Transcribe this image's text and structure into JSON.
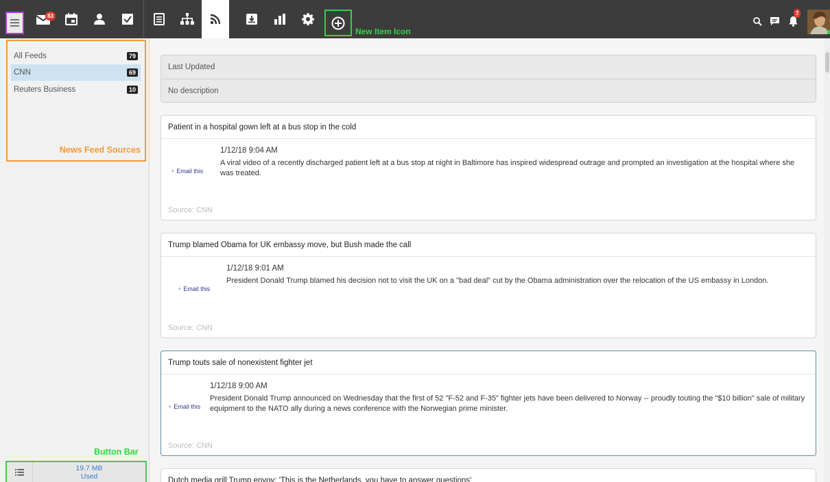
{
  "toolbar": {
    "mail_badge": "83",
    "notifications_badge": "7",
    "new_item_label": "New Item Icon"
  },
  "sidebar": {
    "feeds": [
      {
        "label": "All Feeds",
        "count": "79"
      },
      {
        "label": "CNN",
        "count": "69"
      },
      {
        "label": "Reuters Business",
        "count": "10"
      }
    ],
    "feeds_label": "News Feed Sources",
    "button_bar_label": "Button Bar",
    "storage_value": "19.7 MB",
    "storage_unit": "Used"
  },
  "feed_info": {
    "last_updated": "Last Updated",
    "description": "No description"
  },
  "articles": [
    {
      "title": "Patient in a hospital gown left at a bus stop in the cold",
      "date": "1/12/18 9:04 AM",
      "text": "A viral video of a recently discharged patient left at a bus stop at night in Baltimore has inspired widespread outrage and prompted an investigation at the hospital where she was treated.",
      "email": "Email this",
      "source": "Source: CNN"
    },
    {
      "title": "Trump blamed Obama for UK embassy move, but Bush made the call",
      "date": "1/12/18 9:01 AM",
      "text": "President Donald Trump blamed his decision not to visit the UK on a \"bad deal\" cut by the Obama administration over the relocation of the US embassy in London.",
      "email": "Email this",
      "source": "Source: CNN"
    },
    {
      "title": "Trump touts sale of nonexistent fighter jet",
      "date": "1/12/18 9:00 AM",
      "text": "President Donald Trump announced on Wednesday that the first of 52 \"F-52 and F-35\" fighter jets have been delivered to Norway -- proudly touting the \"$10 billion\" sale of military equipment to the NATO ally during a news conference with the Norwegian prime minister.",
      "email": "Email this",
      "source": "Source: CNN"
    },
    {
      "title": "Dutch media grill Trump envoy: 'This is the Netherlands, you have to answer questions'"
    }
  ]
}
